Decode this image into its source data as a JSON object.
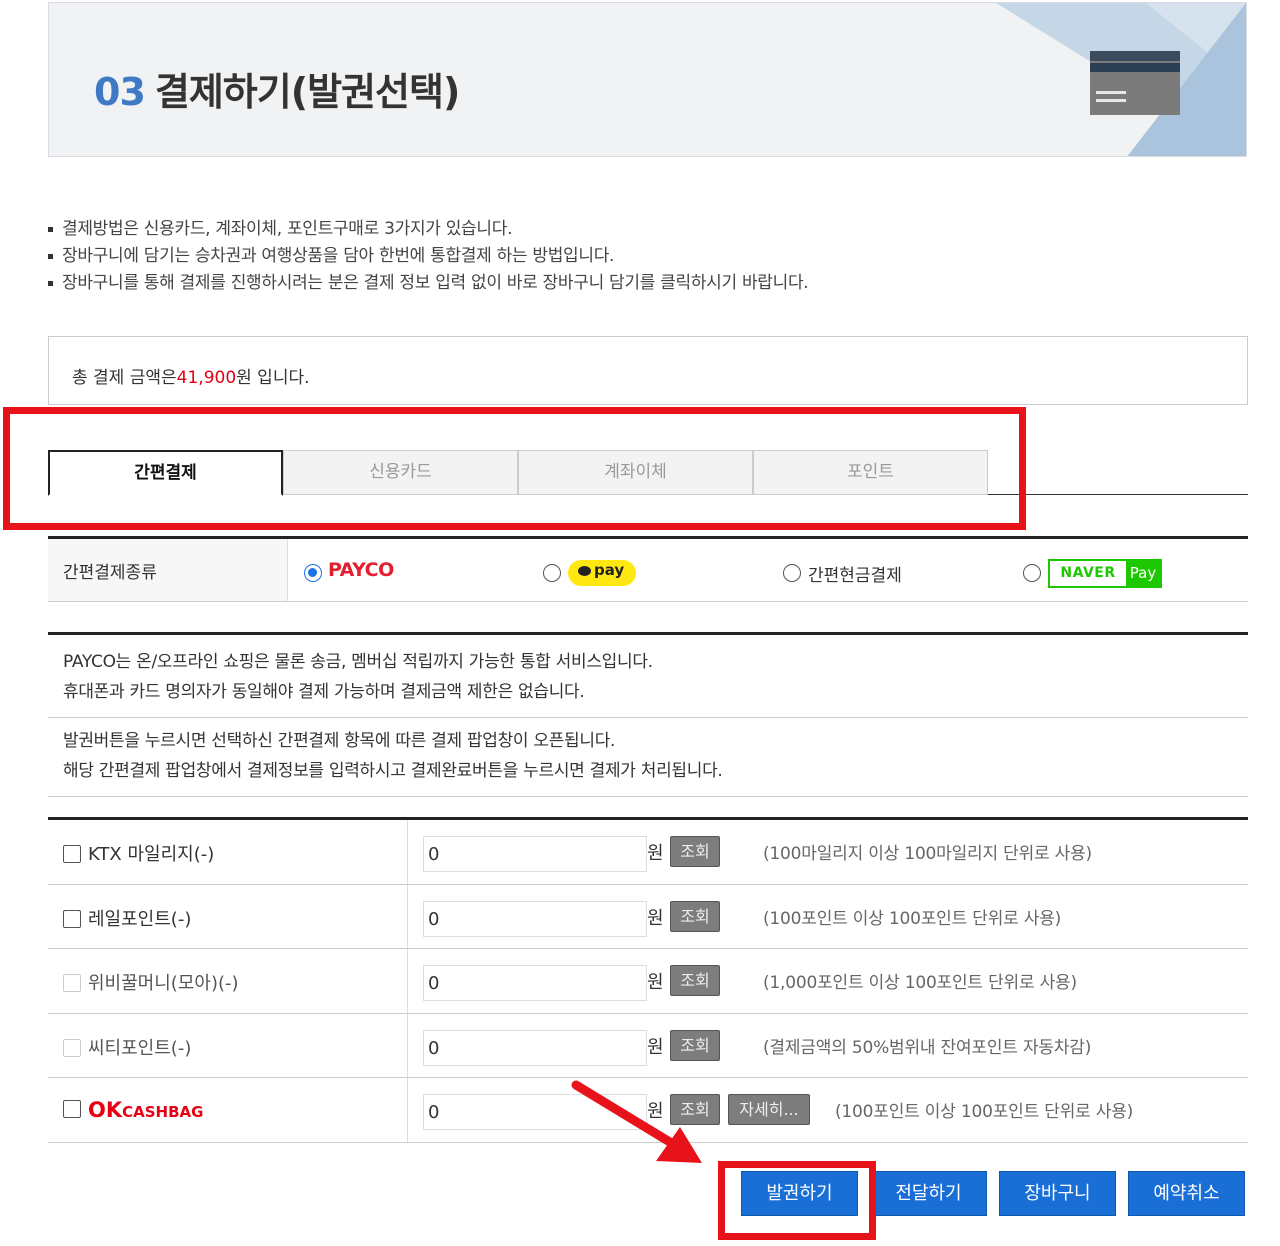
{
  "header": {
    "step_number": "03",
    "title": "결제하기(발권선택)"
  },
  "notices": [
    "결제방법은 신용카드, 계좌이체, 포인트구매로 3가지가 있습니다.",
    "장바구니에 담기는 승차권과 여행상품을 담아 한번에 통합결제 하는 방법입니다.",
    "장바구니를 통해 결제를 진행하시려는 분은 결제 정보 입력 없이 바로 장바구니 담기를 클릭하시기 바랍니다."
  ],
  "total": {
    "prefix": "총 결제 금액은",
    "amount": "41,900",
    "suffix": "원 입니다."
  },
  "tabs": [
    {
      "label": "간편결제",
      "active": true
    },
    {
      "label": "신용카드",
      "active": false
    },
    {
      "label": "계좌이체",
      "active": false
    },
    {
      "label": "포인트",
      "active": false
    }
  ],
  "easypay": {
    "label": "간편결제종류",
    "options": {
      "payco": "PAYCO",
      "kakao": "pay",
      "cash": "간편현금결제",
      "naver_1": "NAVER",
      "naver_2": "Pay"
    },
    "selected": "PAYCO"
  },
  "info": {
    "line1": "PAYCO는 온/오프라인 쇼핑은 물론 송금, 멤버십 적립까지 가능한 통합 서비스입니다.",
    "line2": "휴대폰과 카드 명의자가 동일해야 결제 가능하며 결제금액 제한은 없습니다.",
    "line3": "발권버튼을 누르시면 선택하신 간편결제 항목에 따른 결제 팝업창이 오픈됩니다.",
    "line4": "해당 간편결제 팝업창에서 결제정보를 입력하시고 결제완료버튼을 누르시면 결제가 처리됩니다."
  },
  "points": [
    {
      "label": "KTX 마일리지(-)",
      "value": "0",
      "unit": "원",
      "lookup": "조회",
      "note": "(100마일리지 이상 100마일리지 단위로 사용)"
    },
    {
      "label": "레일포인트(-)",
      "value": "0",
      "unit": "원",
      "lookup": "조회",
      "note": "(100포인트 이상 100포인트 단위로 사용)"
    },
    {
      "label": "위비꿀머니(모아)(-)",
      "value": "0",
      "unit": "원",
      "lookup": "조회",
      "note": "(1,000포인트 이상 100포인트 단위로 사용)"
    },
    {
      "label": "씨티포인트(-)",
      "value": "0",
      "unit": "원",
      "lookup": "조회",
      "note": "(결제금액의 50%범위내 잔여포인트 자동차감)"
    },
    {
      "label_ok": "OK",
      "label_cb": "CASHBAG",
      "value": "0",
      "unit": "원",
      "lookup": "조회",
      "detail": "자세히...",
      "note": "(100포인트 이상 100포인트 단위로 사용)"
    }
  ],
  "actions": {
    "issue": "발권하기",
    "send": "전달하기",
    "cart": "장바구니",
    "cancel": "예약취소"
  },
  "colors": {
    "accent_blue": "#1a6fd6",
    "total_red": "#e60012",
    "annotation_red": "#e8131a",
    "payco_red": "#e41d2f",
    "naver_green": "#1ec800",
    "kakao_yellow": "#ffe812"
  }
}
